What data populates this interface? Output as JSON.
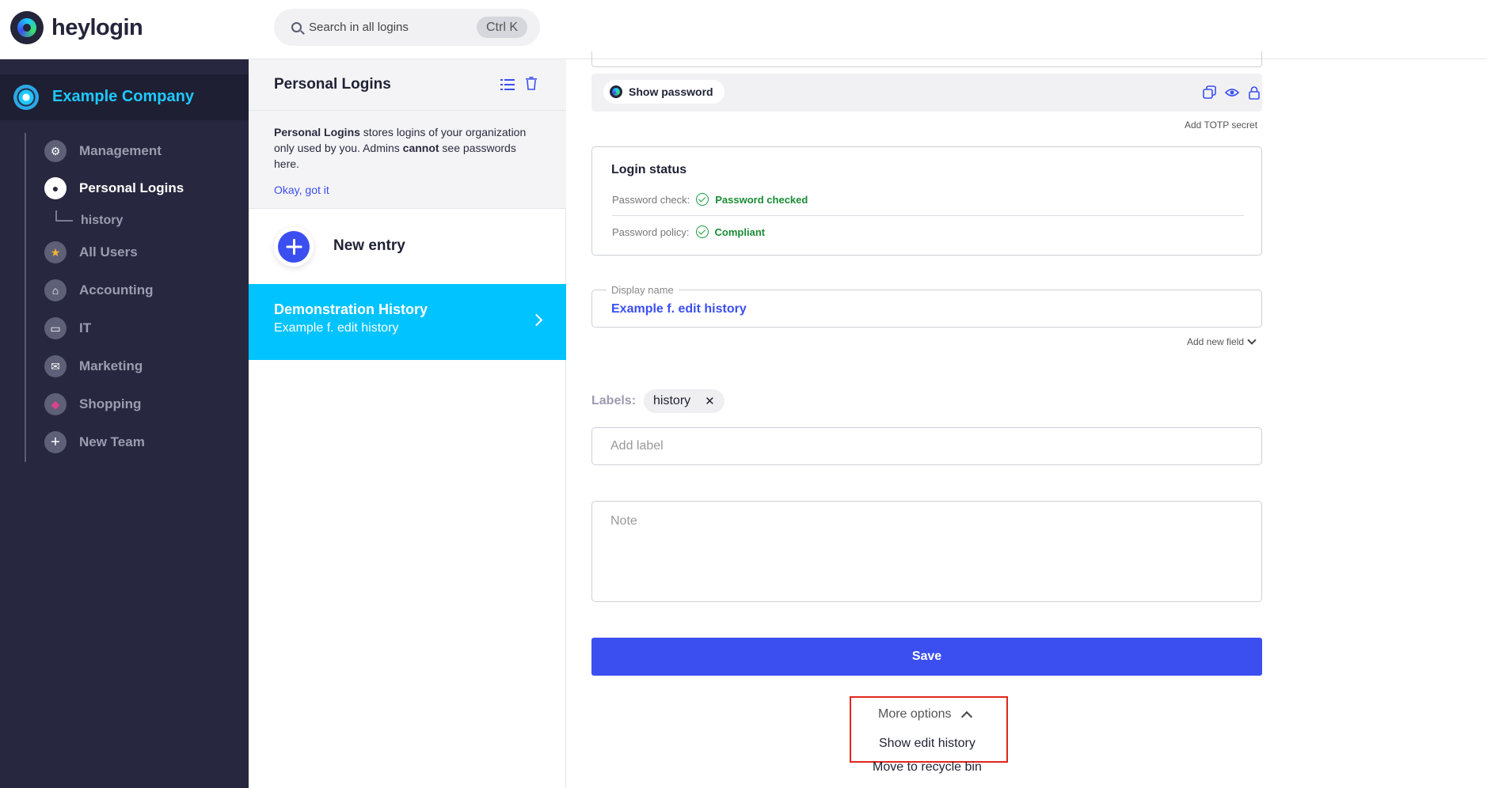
{
  "app": {
    "logo_text": "heylogin"
  },
  "search": {
    "placeholder": "Search in all logins",
    "shortcut": "Ctrl K"
  },
  "sidebar": {
    "company": "Example Company",
    "items": [
      {
        "label": "Management",
        "icon": "gear-icon"
      },
      {
        "label": "Personal Logins",
        "icon": "user-circle-icon",
        "active": true
      },
      {
        "label": "All Users",
        "icon": "star-icon"
      },
      {
        "label": "Accounting",
        "icon": "bank-icon"
      },
      {
        "label": "IT",
        "icon": "laptop-icon"
      },
      {
        "label": "Marketing",
        "icon": "mail-icon"
      },
      {
        "label": "Shopping",
        "icon": "shopping-icon"
      },
      {
        "label": "New Team",
        "icon": "plus-icon"
      }
    ],
    "subitem": "history"
  },
  "middle": {
    "title": "Personal Logins",
    "info": {
      "bold1": "Personal Logins",
      "text1": " stores logins of your organization only used by you. Admins ",
      "bold2": "cannot",
      "text2": " see passwords here.",
      "link": "Okay, got it"
    },
    "new_entry": "New entry",
    "selected": {
      "title": "Demonstration History",
      "subtitle": "Example f. edit history"
    }
  },
  "detail": {
    "show_password": "Show password",
    "add_totp": "Add TOTP secret",
    "status": {
      "title": "Login status",
      "check_label": "Password check:",
      "check_value": "Password checked",
      "policy_label": "Password policy:",
      "policy_value": "Compliant"
    },
    "display_name": {
      "legend": "Display name",
      "value": "Example f. edit history"
    },
    "add_field": "Add new field",
    "labels": {
      "key": "Labels:",
      "chip": "history",
      "placeholder": "Add label"
    },
    "note_placeholder": "Note",
    "save": "Save",
    "more_options": "More options",
    "show_edit_history": "Show edit history",
    "move_to_recycle": "Move to recycle bin"
  },
  "colors": {
    "accent": "#3b4ff0",
    "selected": "#00c3ff",
    "sidebar": "#27283f",
    "success": "#1a8c36",
    "highlight": "#e1261c"
  }
}
